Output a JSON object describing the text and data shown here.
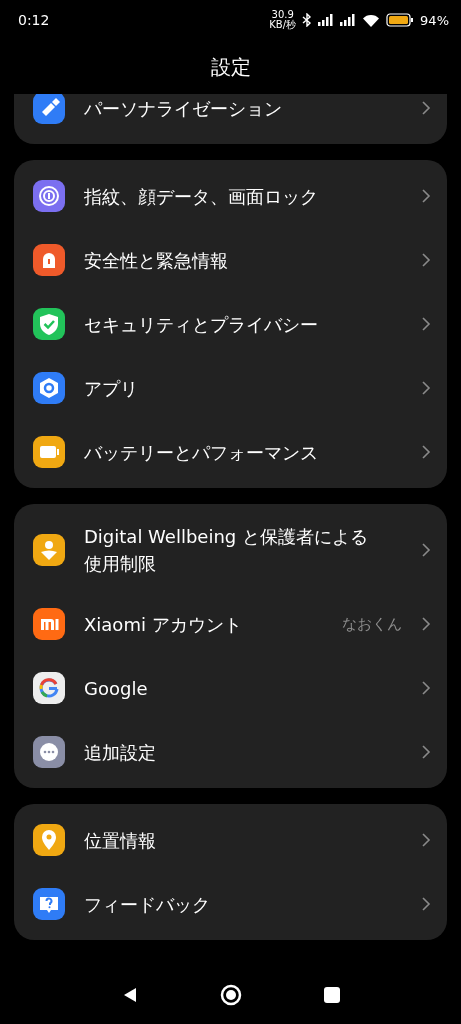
{
  "status_bar": {
    "time": "0:12",
    "speed_value": "30.9",
    "speed_unit": "KB/秒",
    "battery": "94%"
  },
  "title": "設定",
  "groups": [
    {
      "items": [
        {
          "label": "パーソナライゼーション",
          "color": "#2f7cf6"
        }
      ]
    },
    {
      "items": [
        {
          "label": "指紋、顔データ、画面ロック",
          "color": "#7b6ff0"
        },
        {
          "label": "安全性と緊急情報",
          "color": "#ef5a2a"
        },
        {
          "label": "セキュリティとプライバシー",
          "color": "#22c35a"
        },
        {
          "label": "アプリ",
          "color": "#2f7cf6"
        },
        {
          "label": "バッテリーとパフォーマンス",
          "color": "#f0a812"
        }
      ]
    },
    {
      "items": [
        {
          "label": "Digital Wellbeing と保護者による使用制限",
          "color": "#f0a812"
        },
        {
          "label": "Xiaomi アカウント",
          "value": "なおくん",
          "color": "#ff6a13"
        },
        {
          "label": "Google",
          "color": "#eeeeee"
        },
        {
          "label": "追加設定",
          "color": "#8a8ea6"
        }
      ]
    },
    {
      "items": [
        {
          "label": "位置情報",
          "color": "#f0a812"
        },
        {
          "label": "フィードバック",
          "color": "#2f7cf6"
        }
      ]
    }
  ]
}
